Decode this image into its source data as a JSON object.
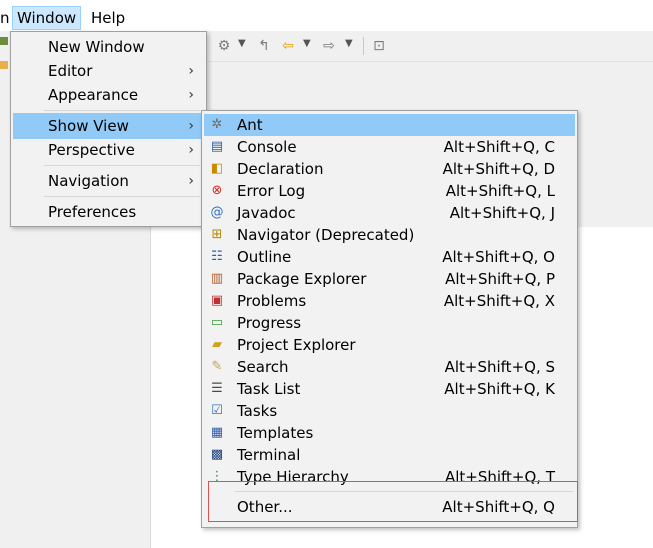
{
  "menubar": {
    "items": [
      {
        "label": "n"
      },
      {
        "label": "Window"
      },
      {
        "label": "Help"
      }
    ]
  },
  "window_menu": {
    "items": [
      {
        "label": "New Window",
        "submenu": false
      },
      {
        "label": "Editor",
        "submenu": true
      },
      {
        "label": "Appearance",
        "submenu": true
      },
      {
        "label": "Show View",
        "submenu": true,
        "highlighted": true
      },
      {
        "label": "Perspective",
        "submenu": true
      },
      {
        "label": "Navigation",
        "submenu": true
      },
      {
        "label": "Preferences",
        "submenu": false
      }
    ],
    "submenu_glyph": "›"
  },
  "show_view_menu": {
    "items": [
      {
        "label": "Ant",
        "shortcut": "",
        "icon": "ant-icon"
      },
      {
        "label": "Console",
        "shortcut": "Alt+Shift+Q, C",
        "icon": "console-icon"
      },
      {
        "label": "Declaration",
        "shortcut": "Alt+Shift+Q, D",
        "icon": "declaration-icon"
      },
      {
        "label": "Error Log",
        "shortcut": "Alt+Shift+Q, L",
        "icon": "error-log-icon"
      },
      {
        "label": "Javadoc",
        "shortcut": "Alt+Shift+Q, J",
        "icon": "javadoc-icon"
      },
      {
        "label": "Navigator (Deprecated)",
        "shortcut": "",
        "icon": "navigator-icon"
      },
      {
        "label": "Outline",
        "shortcut": "Alt+Shift+Q, O",
        "icon": "outline-icon"
      },
      {
        "label": "Package Explorer",
        "shortcut": "Alt+Shift+Q, P",
        "icon": "package-explorer-icon"
      },
      {
        "label": "Problems",
        "shortcut": "Alt+Shift+Q, X",
        "icon": "problems-icon"
      },
      {
        "label": "Progress",
        "shortcut": "",
        "icon": "progress-icon"
      },
      {
        "label": "Project Explorer",
        "shortcut": "",
        "icon": "project-explorer-icon"
      },
      {
        "label": "Search",
        "shortcut": "Alt+Shift+Q, S",
        "icon": "search-icon"
      },
      {
        "label": "Task List",
        "shortcut": "Alt+Shift+Q, K",
        "icon": "task-list-icon"
      },
      {
        "label": "Tasks",
        "shortcut": "",
        "icon": "tasks-icon"
      },
      {
        "label": "Templates",
        "shortcut": "",
        "icon": "templates-icon"
      },
      {
        "label": "Terminal",
        "shortcut": "",
        "icon": "terminal-icon"
      },
      {
        "label": "Type Hierarchy",
        "shortcut": "Alt+Shift+Q, T",
        "icon": "type-hierarchy-icon"
      },
      {
        "label": "Other...",
        "shortcut": "Alt+Shift+Q, Q",
        "icon": ""
      }
    ]
  },
  "colors": {
    "highlight": "#91c9f7",
    "menubar_active": "#cce8ff",
    "annotation_box": "#e05252"
  }
}
